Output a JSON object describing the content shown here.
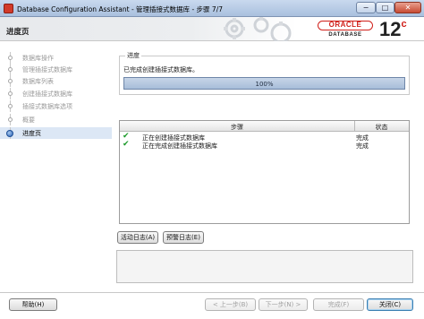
{
  "window": {
    "title": "Database Configuration Assistant - 管理插接式数据库 - 步骤 7/7",
    "minimize": "−",
    "maximize": "□",
    "close": "✕"
  },
  "header": {
    "page_title": "进度页",
    "logo_word": "ORACLE",
    "logo_reg": "®",
    "logo_sub": "DATABASE",
    "version": "12",
    "version_suffix": "c"
  },
  "sidebar": {
    "items": [
      {
        "label": "数据库操作",
        "state": "done"
      },
      {
        "label": "管理插接式数据库",
        "state": "done"
      },
      {
        "label": "数据库列表",
        "state": "done"
      },
      {
        "label": "创建插接式数据库",
        "state": "done"
      },
      {
        "label": "插接式数据库选项",
        "state": "done"
      },
      {
        "label": "概要",
        "state": "done"
      },
      {
        "label": "进度页",
        "state": "active"
      }
    ]
  },
  "progress": {
    "section_title": "进度",
    "status_text": "已完成创建插接式数据库。",
    "percent": 100,
    "percent_label": "100%"
  },
  "steps_table": {
    "headers": {
      "step": "步骤",
      "status": "状态"
    },
    "rows": [
      {
        "step": "正在创建插接式数据库",
        "status": "完成",
        "icon": "check-icon"
      },
      {
        "step": "正在完成创建插接式数据库",
        "status": "完成",
        "icon": "check-icon"
      }
    ]
  },
  "buttons": {
    "activity_log": "活动日志(A)",
    "alert_log": "预警日志(E)",
    "help": "帮助(H)",
    "back": "< 上一步(B)",
    "next": "下一步(N) >",
    "finish": "完成(F)",
    "close": "关闭(C)"
  },
  "colors": {
    "brand_red": "#d0201a",
    "progress_fill": "#a7bdd9",
    "check_green": "#1c9a2a",
    "active_nav": "#dce7f5"
  }
}
